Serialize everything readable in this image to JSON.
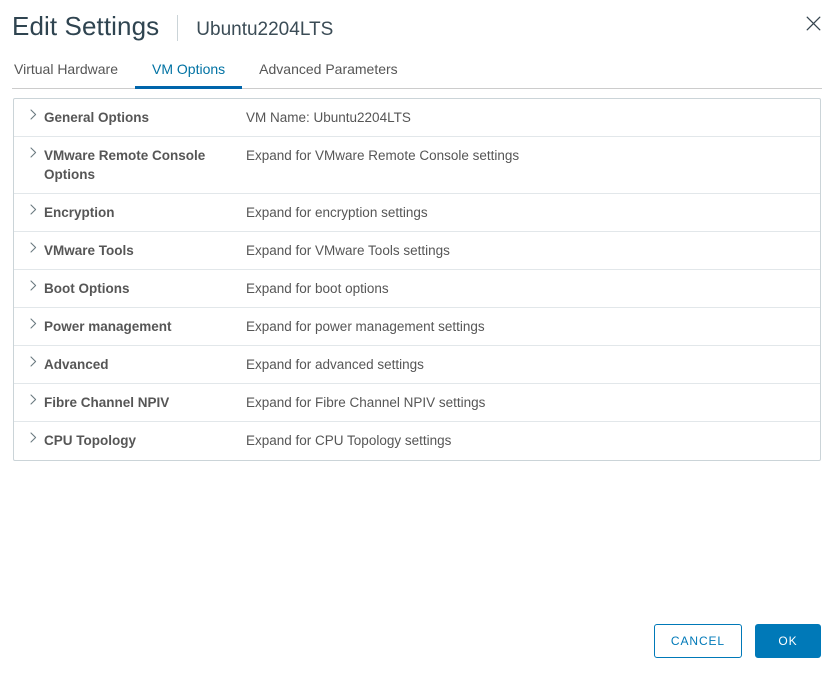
{
  "header": {
    "title": "Edit Settings",
    "subtitle": "Ubuntu2204LTS",
    "close_icon": "close-icon"
  },
  "tabs": [
    {
      "label": "Virtual Hardware",
      "active": false
    },
    {
      "label": "VM Options",
      "active": true
    },
    {
      "label": "Advanced Parameters",
      "active": false
    }
  ],
  "rows": [
    {
      "name": "General Options",
      "description": "VM Name: Ubuntu2204LTS",
      "icon": "chevron-right-icon"
    },
    {
      "name": "VMware Remote Console Options",
      "description": "Expand for VMware Remote Console settings",
      "icon": "chevron-right-icon"
    },
    {
      "name": "Encryption",
      "description": "Expand for encryption settings",
      "icon": "chevron-right-icon"
    },
    {
      "name": "VMware Tools",
      "description": "Expand for VMware Tools settings",
      "icon": "chevron-right-icon"
    },
    {
      "name": "Boot Options",
      "description": "Expand for boot options",
      "icon": "chevron-right-icon"
    },
    {
      "name": "Power management",
      "description": "Expand for power management settings",
      "icon": "chevron-right-icon"
    },
    {
      "name": "Advanced",
      "description": "Expand for advanced settings",
      "icon": "chevron-right-icon"
    },
    {
      "name": "Fibre Channel NPIV",
      "description": "Expand for Fibre Channel NPIV settings",
      "icon": "chevron-right-icon"
    },
    {
      "name": "CPU Topology",
      "description": "Expand for CPU Topology settings",
      "icon": "chevron-right-icon"
    }
  ],
  "footer": {
    "cancel_label": "CANCEL",
    "ok_label": "OK"
  },
  "colors": {
    "accent_blue": "#0079b8",
    "tab_underline": "#0065ab",
    "tab_active_text": "#0072a3",
    "title_text": "#2f4450",
    "body_text": "#565656",
    "grid_border": "#cbd4d8",
    "row_divider": "#e2e7ea"
  }
}
